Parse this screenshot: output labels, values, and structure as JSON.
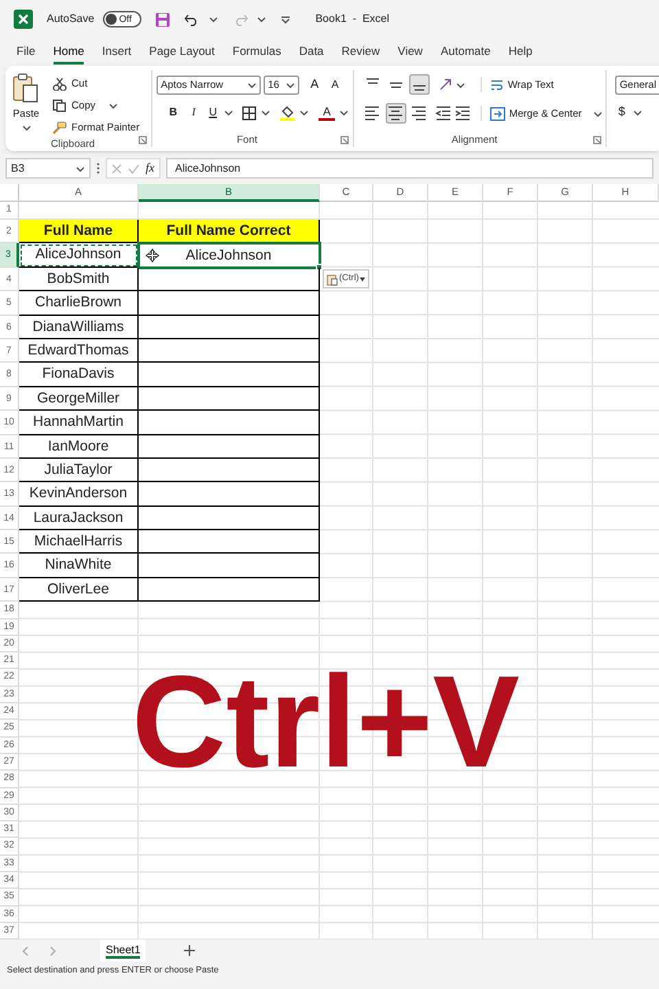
{
  "title_bar": {
    "autosave_label": "AutoSave",
    "autosave_on": false,
    "autosave_state": "Off",
    "title": "Book1  -  Excel"
  },
  "ribbon_tabs": [
    {
      "label": "File",
      "selected": false
    },
    {
      "label": "Home",
      "selected": true
    },
    {
      "label": "Insert",
      "selected": false
    },
    {
      "label": "Page Layout",
      "selected": false
    },
    {
      "label": "Formulas",
      "selected": false
    },
    {
      "label": "Data",
      "selected": false
    },
    {
      "label": "Review",
      "selected": false
    },
    {
      "label": "View",
      "selected": false
    },
    {
      "label": "Automate",
      "selected": false
    },
    {
      "label": "Help",
      "selected": false
    }
  ],
  "clipboard": {
    "paste": "Paste",
    "items": [
      "Cut",
      "Copy",
      "Format Painter"
    ],
    "label": "Clipboard"
  },
  "font": {
    "name": "Aptos Narrow",
    "size": "16",
    "grow": "A",
    "shrink": "A",
    "bold": "B",
    "italic": "I",
    "underline": "U",
    "font_color": "A",
    "label": "Font"
  },
  "alignment": {
    "vertical": [
      {
        "kind": "top",
        "selected": false
      },
      {
        "kind": "middle",
        "selected": false
      },
      {
        "kind": "bottom",
        "selected": true
      }
    ],
    "horizontal": [
      {
        "kind": "left",
        "selected": false
      },
      {
        "kind": "center",
        "selected": true
      },
      {
        "kind": "right",
        "selected": false
      }
    ],
    "wrap_text": "Wrap Text",
    "merge_center": "Merge & Center",
    "label": "Alignment"
  },
  "number": {
    "format": "General",
    "currency": "$"
  },
  "formula_bar": {
    "name_box": "B3",
    "fx": "fx",
    "value": "AliceJohnson"
  },
  "columns": [
    {
      "label": "A",
      "selected": false
    },
    {
      "label": "B",
      "selected": true
    },
    {
      "label": "C",
      "selected": false
    },
    {
      "label": "D",
      "selected": false
    },
    {
      "label": "E",
      "selected": false
    },
    {
      "label": "F",
      "selected": false
    },
    {
      "label": "G",
      "selected": false
    },
    {
      "label": "H",
      "selected": false
    }
  ],
  "row_numbers": [
    "1",
    "2",
    "3",
    "4",
    "5",
    "6",
    "7",
    "8",
    "9",
    "10",
    "11",
    "12",
    "13",
    "14",
    "15",
    "16",
    "17",
    "18",
    "19",
    "20",
    "21",
    "22",
    "23",
    "24",
    "25",
    "26",
    "27",
    "28",
    "29",
    "30",
    "31",
    "32",
    "33",
    "34",
    "35",
    "36",
    "37"
  ],
  "table": {
    "headers": [
      "Full Name",
      "Full Name Correct"
    ],
    "rows": [
      {
        "full_name": "AliceJohnson",
        "full_name_correct": "AliceJohnson",
        "copied": true,
        "selected": true
      },
      {
        "full_name": "BobSmith",
        "copied": false,
        "selected": false
      },
      {
        "full_name": "CharlieBrown",
        "copied": false,
        "selected": false
      },
      {
        "full_name": "DianaWilliams",
        "copied": false,
        "selected": false
      },
      {
        "full_name": "EdwardThomas",
        "copied": false,
        "selected": false
      },
      {
        "full_name": "FionaDavis",
        "copied": false,
        "selected": false
      },
      {
        "full_name": "GeorgeMiller",
        "copied": false,
        "selected": false
      },
      {
        "full_name": "HannahMartin",
        "copied": false,
        "selected": false
      },
      {
        "full_name": "IanMoore",
        "copied": false,
        "selected": false
      },
      {
        "full_name": "JuliaTaylor",
        "copied": false,
        "selected": false
      },
      {
        "full_name": "KevinAnderson",
        "copied": false,
        "selected": false
      },
      {
        "full_name": "LauraJackson",
        "copied": false,
        "selected": false
      },
      {
        "full_name": "MichaelHarris",
        "copied": false,
        "selected": false
      },
      {
        "full_name": "NinaWhite",
        "copied": false,
        "selected": false
      },
      {
        "full_name": "OliverLee",
        "copied": false,
        "selected": false
      }
    ]
  },
  "paste_options": "(Ctrl)",
  "overlay_caption": "Ctrl+V",
  "sheet_tabs": [
    {
      "label": "Sheet1",
      "selected": true
    }
  ],
  "status_bar": "Select destination and press ENTER or choose Paste"
}
